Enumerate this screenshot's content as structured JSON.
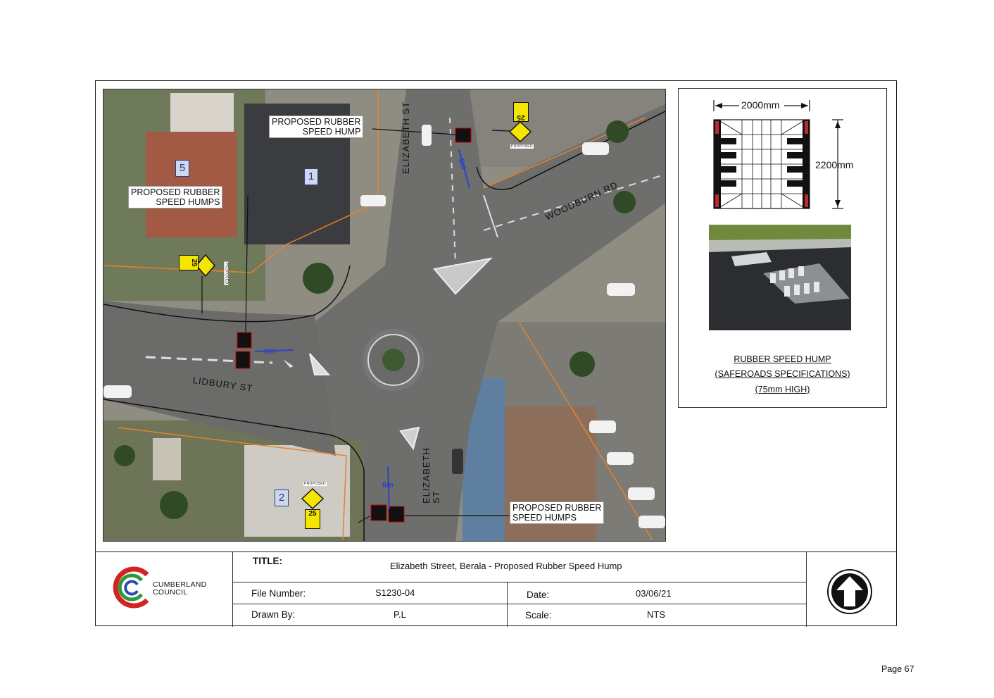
{
  "map": {
    "callouts": {
      "top": "PROPOSED RUBBER\nSPEED HUMP",
      "left": "PROPOSED RUBBER\nSPEED HUMPS",
      "bottom": "PROPOSED RUBBER\nSPEED HUMPS"
    },
    "roads": {
      "elizabeth_north": "ELIZABETH ST",
      "elizabeth_south": "ELIZABETH\nST",
      "woodburn": "WOODBURN RD",
      "lidbury": "LIDBURY ST"
    },
    "house_numbers": [
      "5",
      "1",
      "2"
    ],
    "measurement": "6m",
    "speed_sign": "25",
    "proposed_tag": "PROPOSED"
  },
  "detail": {
    "width_dim": "2000mm",
    "length_dim": "2200mm",
    "spec_lines": [
      "RUBBER SPEED HUMP",
      "(SAFEROADS SPECIFICATIONS)",
      "(75mm HIGH)"
    ]
  },
  "titleblock": {
    "logo_text": "CUMBERLAND\nCOUNCIL",
    "title_label": "TITLE:",
    "title_value": "Elizabeth Street, Berala - Proposed Rubber Speed Hump",
    "file_label": "File Number:",
    "file_value": "S1230-04",
    "date_label": "Date:",
    "date_value": "03/06/21",
    "drawn_label": "Drawn By:",
    "drawn_value": "P.L",
    "scale_label": "Scale:",
    "scale_value": "NTS",
    "icon": "north-arrow-icon"
  },
  "page_number": "Page 67",
  "colors": {
    "road": "#707070",
    "boundary": "#e8822a",
    "measure": "#2d44c7",
    "sign_yellow": "#f5e600"
  }
}
